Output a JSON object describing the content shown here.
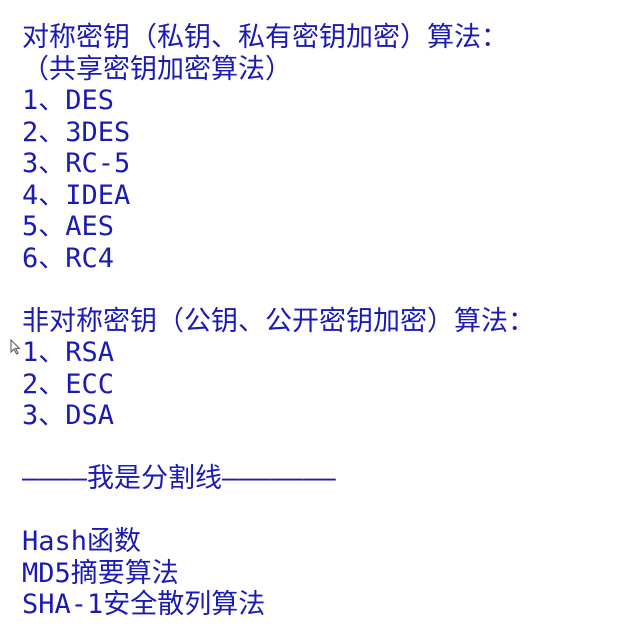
{
  "symmetric": {
    "heading": "对称密钥（私钥、私有密钥加密）算法：",
    "subheading": "（共享密钥加密算法）",
    "items": [
      "1、DES",
      "2、3DES",
      "3、RC-5",
      "4、IDEA",
      "5、AES",
      "6、RC4"
    ]
  },
  "asymmetric": {
    "heading": "非对称密钥（公钥、公开密钥加密）算法：",
    "items": [
      "1、RSA",
      "2、ECC",
      "3、DSA"
    ]
  },
  "divider": "————我是分割线———————",
  "hash": {
    "items": [
      "Hash函数",
      "MD5摘要算法",
      "SHA-1安全散列算法"
    ]
  },
  "colors": {
    "text": "#1a1ab4",
    "background": "#ffffff"
  }
}
